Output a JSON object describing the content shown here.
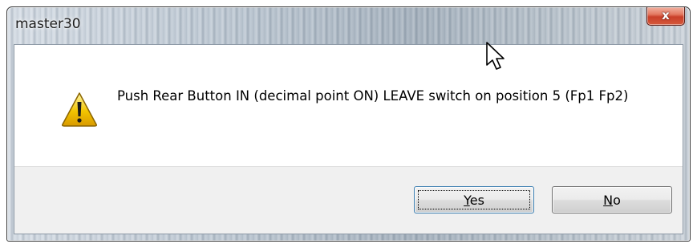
{
  "window": {
    "title": "master30",
    "close_symbol": "x"
  },
  "message": {
    "icon": "warning-icon",
    "text": "Push Rear Button IN (decimal point ON) LEAVE switch on position 5 (Fp1 Fp2)"
  },
  "buttons": {
    "yes": {
      "accel": "Y",
      "rest": "es"
    },
    "no": {
      "accel": "N",
      "rest": "o"
    }
  },
  "colors": {
    "close_button": "#c9402a",
    "warning_fill": "#f2c400",
    "focus_border": "#3c7fb1"
  }
}
